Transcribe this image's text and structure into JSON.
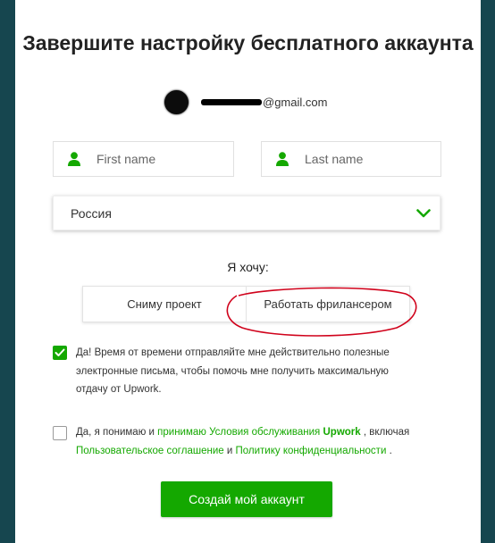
{
  "page": {
    "title": "Завершите настройку бесплатного аккаунта"
  },
  "account": {
    "email_visible": "@gmail.com"
  },
  "form": {
    "first_name_placeholder": "First name",
    "last_name_placeholder": "Last name",
    "country_value": "Россия",
    "want_label": "Я хочу:",
    "role_options": [
      "Сниму проект",
      "Работать фрилансером"
    ],
    "newsletter": {
      "checked": true,
      "text": "Да! Время от времени отправляйте мне действительно полезные электронные письма, чтобы помочь мне получить максимальную отдачу от Upwork."
    },
    "terms": {
      "checked": false,
      "prefix": "Да, я понимаю и",
      "link_accept": "принимаю",
      "link_terms": "Условия обслуживания",
      "link_brand": "Upwork",
      "mid": ", включая",
      "link_user_agreement": "Пользовательское соглашение",
      "and": "и",
      "link_privacy": "Политику конфиденциальности",
      "end": "."
    },
    "submit_label": "Создай мой аккаунт"
  },
  "colors": {
    "accent": "#14a800",
    "background": "#16464f",
    "annotation": "#d0021b"
  },
  "icons": {
    "person": "person-icon",
    "chevron": "chevron-down-icon",
    "check": "checkmark-icon"
  }
}
